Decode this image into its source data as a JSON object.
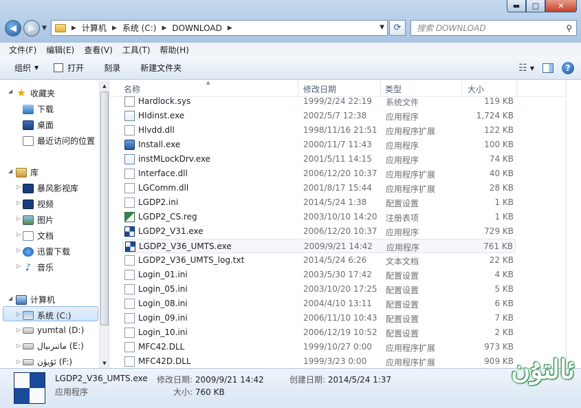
{
  "window": {
    "min_glyph": "▬",
    "max_glyph": "□",
    "close_glyph": "✕"
  },
  "address": {
    "crumbs": [
      "计算机",
      "系统 (C:)",
      "DOWNLOAD"
    ]
  },
  "search": {
    "placeholder": "搜索 DOWNLOAD"
  },
  "menu": [
    "文件(F)",
    "编辑(E)",
    "查看(V)",
    "工具(T)",
    "帮助(H)"
  ],
  "toolbar": {
    "organize": "组织",
    "open": "打开",
    "burn": "刻录",
    "new_folder": "新建文件夹"
  },
  "nav": {
    "favorites": "收藏夹",
    "downloads": "下载",
    "desktop": "桌面",
    "recent": "最近访问的位置",
    "libraries": "库",
    "baofeng": "暴风影视库",
    "videos": "视频",
    "pictures": "图片",
    "documents": "文档",
    "xunlei": "迅雷下载",
    "music": "音乐",
    "computer": "计算机",
    "drive_c": "系统 (C:)",
    "drive_d": "yumtal (D:)",
    "drive_e": "ماتىرىيال (E:)",
    "drive_f": "ئۆيۈن (F:)"
  },
  "columns": {
    "name": "名称",
    "date": "修改日期",
    "type": "类型",
    "size": "大小"
  },
  "files": [
    {
      "name": "Hardlock.sys",
      "date": "1999/2/24 22:19",
      "type": "系统文件",
      "size": "119 KB",
      "icon": "sys-file-icon"
    },
    {
      "name": "HIdinst.exe",
      "date": "2002/5/7 12:38",
      "type": "应用程序",
      "size": "1,724 KB",
      "icon": "exe-file-icon"
    },
    {
      "name": "Hlvdd.dll",
      "date": "1998/11/16 21:51",
      "type": "应用程序扩展",
      "size": "122 KB",
      "icon": "dll-file-icon"
    },
    {
      "name": "Install.exe",
      "date": "2000/11/7 11:43",
      "type": "应用程序",
      "size": "100 KB",
      "icon": "installer-icon"
    },
    {
      "name": "instMLockDrv.exe",
      "date": "2001/5/11 14:15",
      "type": "应用程序",
      "size": "74 KB",
      "icon": "exe-file-icon"
    },
    {
      "name": "Interface.dll",
      "date": "2006/12/20 10:37",
      "type": "应用程序扩展",
      "size": "40 KB",
      "icon": "dll-file-icon"
    },
    {
      "name": "LGComm.dll",
      "date": "2001/8/17 15:44",
      "type": "应用程序扩展",
      "size": "28 KB",
      "icon": "dll-file-icon"
    },
    {
      "name": "LGDP2.ini",
      "date": "2014/5/24 1:38",
      "type": "配置设置",
      "size": "1 KB",
      "icon": "ini-file-icon"
    },
    {
      "name": "LGDP2_CS.reg",
      "date": "2003/10/10 14:20",
      "type": "注册表项",
      "size": "1 KB",
      "icon": "reg-file-icon"
    },
    {
      "name": "LGDP2_V31.exe",
      "date": "2006/12/20 10:37",
      "type": "应用程序",
      "size": "729 KB",
      "icon": "mfc-app-icon"
    },
    {
      "name": "LGDP2_V36_UMTS.exe",
      "date": "2009/9/21 14:42",
      "type": "应用程序",
      "size": "761 KB",
      "icon": "mfc-app-icon"
    },
    {
      "name": "LGDP2_V36_UMTS_log.txt",
      "date": "2014/5/24 6:26",
      "type": "文本文档",
      "size": "22 KB",
      "icon": "txt-file-icon"
    },
    {
      "name": "Login_01.ini",
      "date": "2003/5/30 17:42",
      "type": "配置设置",
      "size": "4 KB",
      "icon": "ini-file-icon"
    },
    {
      "name": "Login_05.ini",
      "date": "2003/10/20 17:25",
      "type": "配置设置",
      "size": "5 KB",
      "icon": "ini-file-icon"
    },
    {
      "name": "Login_08.ini",
      "date": "2004/4/10 13:11",
      "type": "配置设置",
      "size": "6 KB",
      "icon": "ini-file-icon"
    },
    {
      "name": "Login_09.ini",
      "date": "2006/11/10 10:43",
      "type": "配置设置",
      "size": "7 KB",
      "icon": "ini-file-icon"
    },
    {
      "name": "Login_10.ini",
      "date": "2006/12/19 10:52",
      "type": "配置设置",
      "size": "2 KB",
      "icon": "ini-file-icon"
    },
    {
      "name": "MFC42.DLL",
      "date": "1999/10/27 0:00",
      "type": "应用程序扩展",
      "size": "973 KB",
      "icon": "dll-file-icon"
    },
    {
      "name": "MFC42D.DLL",
      "date": "1999/3/23 0:00",
      "type": "应用程序扩展",
      "size": "909 KB",
      "icon": "dll-file-icon"
    }
  ],
  "details": {
    "name": "LGDP2_V36_UMTS.exe",
    "type": "应用程序",
    "modified_label": "修改日期:",
    "modified": "2009/9/21 14:42",
    "created_label": "创建日期:",
    "created": "2014/5/24 1:37",
    "size_label": "大小:",
    "size": "760 KB"
  },
  "watermark": {
    "text": "ئالتۇن"
  }
}
